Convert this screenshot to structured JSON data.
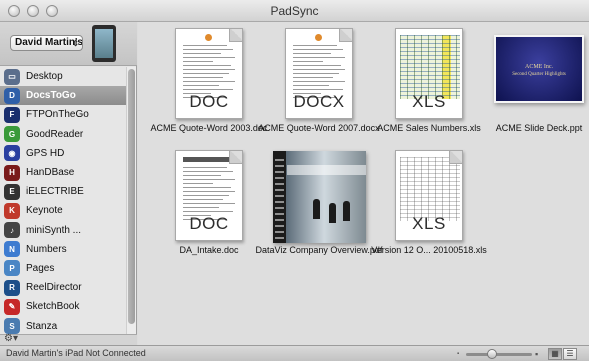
{
  "window": {
    "title": "PadSync"
  },
  "device": {
    "selected": "David Martin's"
  },
  "apps": [
    {
      "label": "Desktop",
      "icon": "desktop-icon",
      "color": "#5b6e8c"
    },
    {
      "label": "DocsToGo",
      "icon": "docstogo-icon",
      "color": "#2f5fa8"
    },
    {
      "label": "FTPOnTheGo",
      "icon": "ftp-icon",
      "color": "#1a2f6e"
    },
    {
      "label": "GoodReader",
      "icon": "goodreader-icon",
      "color": "#3a9a3a"
    },
    {
      "label": "GPS HD",
      "icon": "gps-icon",
      "color": "#2a3fa0"
    },
    {
      "label": "HanDBase",
      "icon": "handbase-icon",
      "color": "#7a1a1a"
    },
    {
      "label": "iELECTRIBE",
      "icon": "electribe-icon",
      "color": "#333333"
    },
    {
      "label": "Keynote",
      "icon": "keynote-icon",
      "color": "#c0392b"
    },
    {
      "label": "miniSynth ...",
      "icon": "minisynth-icon",
      "color": "#444444"
    },
    {
      "label": "Numbers",
      "icon": "numbers-icon",
      "color": "#3d7bd0"
    },
    {
      "label": "Pages",
      "icon": "pages-icon",
      "color": "#4a86c5"
    },
    {
      "label": "ReelDirector",
      "icon": "reeldirector-icon",
      "color": "#1d4f8a"
    },
    {
      "label": "SketchBook",
      "icon": "sketchbook-icon",
      "color": "#c62828"
    },
    {
      "label": "Stanza",
      "icon": "stanza-icon",
      "color": "#4a7bb0"
    }
  ],
  "selected_app_index": 1,
  "documents": [
    {
      "caption": "ACME Quote-Word 2003.doc",
      "badge": "DOC",
      "kind": "text"
    },
    {
      "caption": "ACME Quote-Word 2007.docx",
      "badge": "DOCX",
      "kind": "text"
    },
    {
      "caption": "ACME Sales Numbers.xls",
      "badge": "XLS",
      "kind": "sheet"
    },
    {
      "caption": "ACME Slide Deck.ppt",
      "badge": "",
      "kind": "slide",
      "slide_title": "ACME Inc.",
      "slide_subtitle": "Second Quarter Highlights"
    },
    {
      "caption": "DA_Intake.doc",
      "badge": "DOC",
      "kind": "form"
    },
    {
      "caption": "DataViz Company Overview.pdf",
      "badge": "",
      "kind": "pdf"
    },
    {
      "caption": "Version 12 O... 20100518.xls",
      "badge": "XLS",
      "kind": "sheet-plain"
    }
  ],
  "status": {
    "text": "David Martin's iPad Not Connected"
  },
  "zoom": {
    "level": 0.4
  },
  "view_modes": {
    "grid": "▦",
    "list": "☰",
    "active": "grid"
  }
}
